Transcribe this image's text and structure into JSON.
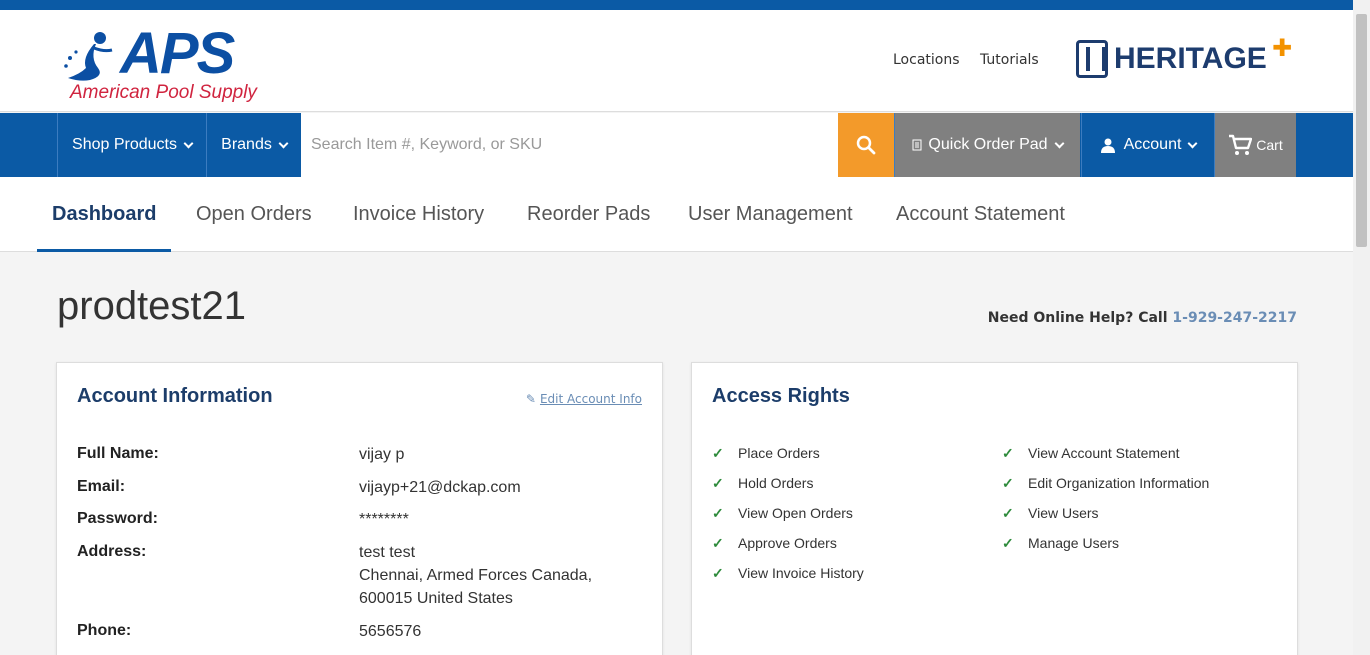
{
  "brand": {
    "logo_text": "APS",
    "logo_subtitle": "American Pool Supply",
    "partner_logo": "HERITAGE"
  },
  "top_links": [
    "Locations",
    "Tutorials"
  ],
  "nav": {
    "shop_products": "Shop Products",
    "brands": "Brands",
    "search_placeholder": "Search Item #, Keyword, or SKU",
    "quick_order_pad": "Quick Order Pad",
    "account": "Account",
    "cart": "Cart",
    "search_color": "#f39a2a"
  },
  "tabs": [
    {
      "label": "Dashboard",
      "active": true
    },
    {
      "label": "Open Orders"
    },
    {
      "label": "Invoice History"
    },
    {
      "label": "Reorder Pads"
    },
    {
      "label": "User Management"
    },
    {
      "label": "Account Statement"
    }
  ],
  "page": {
    "title": "prodtest21",
    "help_prefix": "Need Online Help? Call",
    "help_phone": "1-929-247-2217"
  },
  "account_info": {
    "heading": "Account Information",
    "edit_label": "Edit Account Info",
    "rows": [
      {
        "label": "Full Name:",
        "value": "vijay p"
      },
      {
        "label": "Email:",
        "value": "vijayp+21@dckap.com"
      },
      {
        "label": "Password:",
        "value": "********"
      },
      {
        "label": "Address:",
        "value_lines": [
          "test test",
          "Chennai, Armed Forces Canada,",
          "600015 United States"
        ]
      },
      {
        "label": "Phone:",
        "value": "5656576"
      }
    ]
  },
  "access_rights": {
    "heading": "Access Rights",
    "left": [
      "Place Orders",
      "Hold Orders",
      "View Open Orders",
      "Approve Orders",
      "View Invoice History"
    ],
    "right": [
      "View Account Statement",
      "Edit Organization Information",
      "View Users",
      "Manage Users"
    ]
  },
  "colors": {
    "primary": "#0b5aa5",
    "heading": "#1c3d6a",
    "check": "#2e8b3c"
  }
}
